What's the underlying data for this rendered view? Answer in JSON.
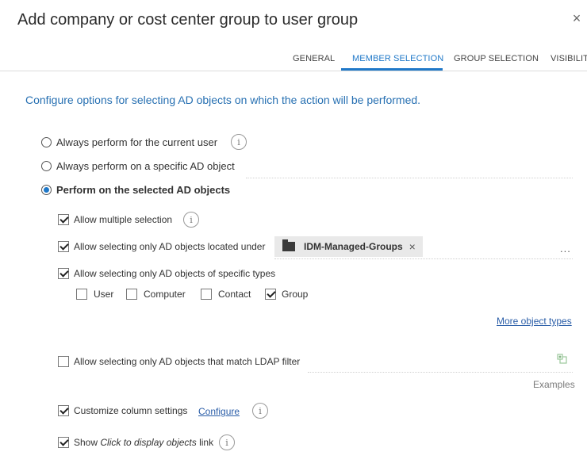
{
  "dialog": {
    "title": "Add company or cost center group to user group",
    "close_label": "×"
  },
  "tabs": [
    {
      "label": "GENERAL",
      "active": false
    },
    {
      "label": "MEMBER SELECTION",
      "active": true
    },
    {
      "label": "GROUP SELECTION",
      "active": false
    },
    {
      "label": "VISIBILITY",
      "active": false
    }
  ],
  "intro": "Configure options for selecting AD objects on which the action will be performed.",
  "target_options": [
    {
      "label": "Always perform for the current user",
      "selected": false
    },
    {
      "label": "Always perform on a specific AD object",
      "selected": false
    },
    {
      "label": "Perform on the selected AD objects",
      "selected": true
    }
  ],
  "options": {
    "multiple": {
      "label": "Allow multiple selection",
      "checked": true
    },
    "located_under": {
      "label": "Allow selecting only AD objects located under",
      "checked": true,
      "chip": "IDM-Managed-Groups",
      "chip_remove": "×",
      "browse": "..."
    },
    "specific_types": {
      "label": "Allow selecting only AD objects of specific types",
      "checked": true
    },
    "types": [
      {
        "label": "User",
        "checked": false
      },
      {
        "label": "Computer",
        "checked": false
      },
      {
        "label": "Contact",
        "checked": false
      },
      {
        "label": "Group",
        "checked": true
      }
    ],
    "more_types": "More object types",
    "ldap": {
      "label": "Allow selecting only AD objects that match LDAP filter",
      "checked": false,
      "examples": "Examples"
    },
    "columns": {
      "label": "Customize column settings",
      "checked": true,
      "link": "Configure"
    },
    "show_link": {
      "label_pre": "Show ",
      "label_em": "Click to display objects",
      "label_post": " link",
      "checked": true
    }
  },
  "icons": {
    "info": "info-icon",
    "folder": "folder-icon",
    "ldap": "filter-add-icon",
    "close": "close-icon"
  },
  "colors": {
    "accent": "#1f78c8",
    "intro_text": "#2770b2",
    "link": "#2b5ea8"
  }
}
